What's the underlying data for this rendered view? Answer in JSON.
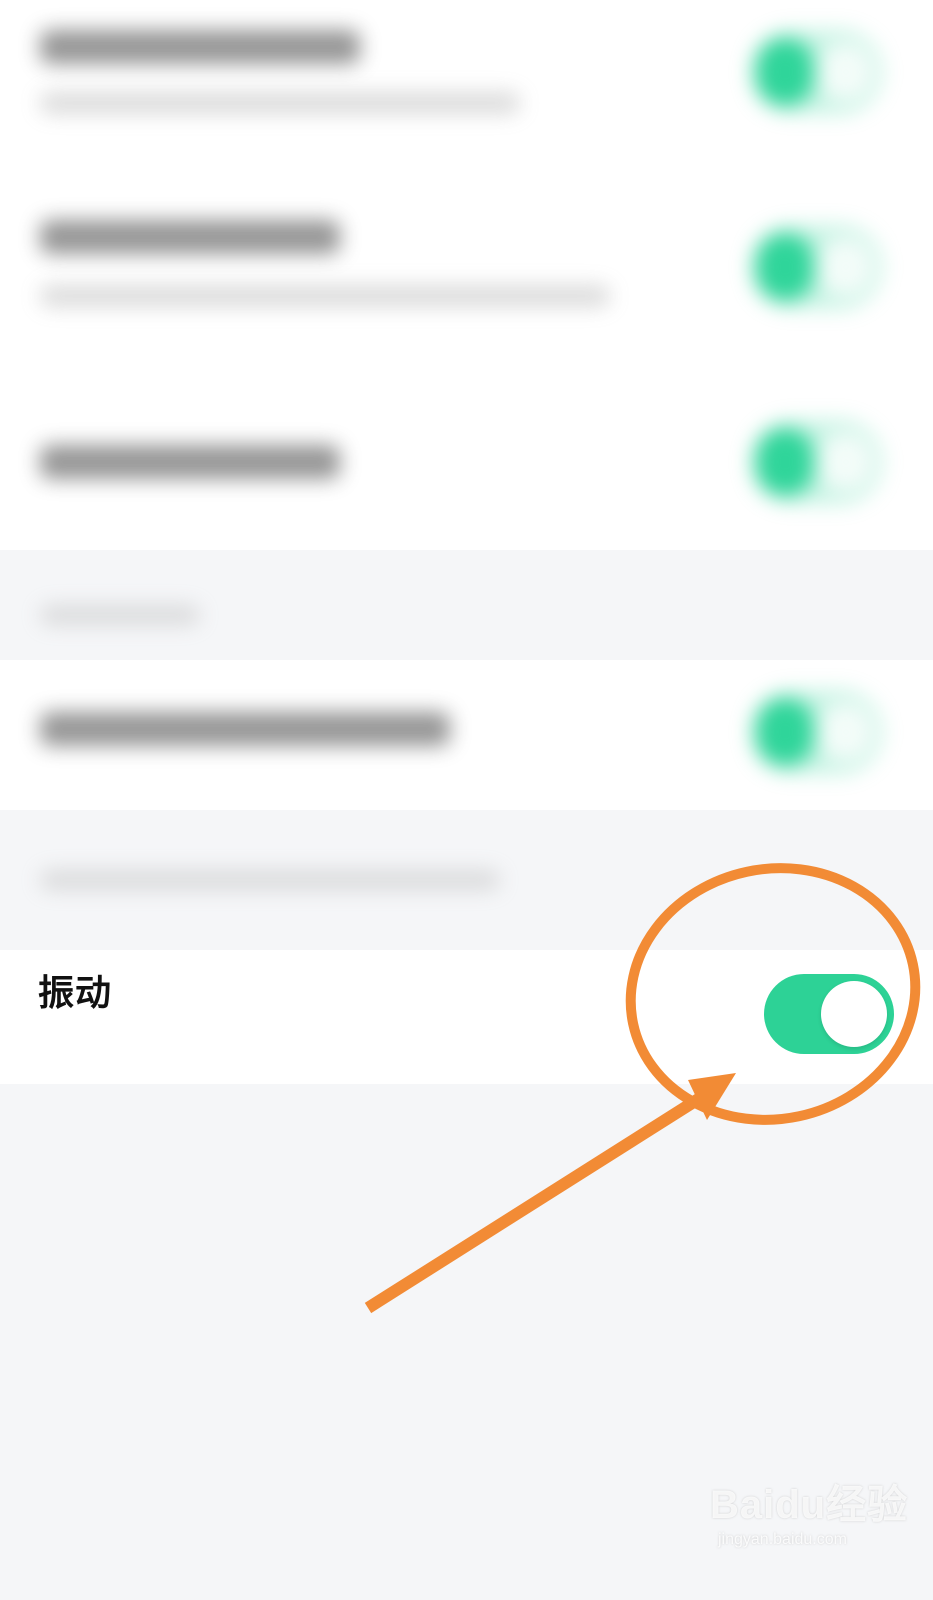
{
  "vibration": {
    "label": "振动",
    "toggle_on": true
  },
  "colors": {
    "toggle_on": "#2dd296",
    "annotation": "#f28b35",
    "background": "#f5f6f8"
  },
  "watermark": {
    "logo": "Baidu经验",
    "url": "jingyan.baidu.com"
  }
}
